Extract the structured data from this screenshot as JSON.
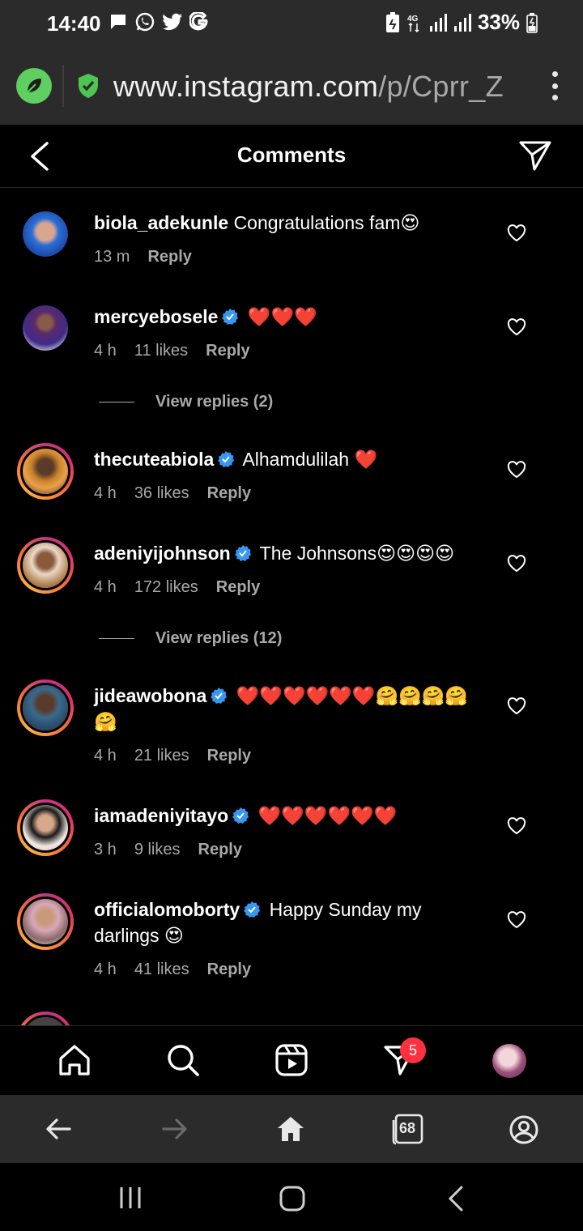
{
  "status_bar": {
    "time": "14:40",
    "left_icons": [
      "message-icon",
      "whatsapp-icon",
      "twitter-icon",
      "google-icon"
    ],
    "network": "4G",
    "battery_percent": "33%"
  },
  "browser": {
    "url_host": "www.instagram.com",
    "url_path": "/p/Cprr_Z",
    "accent_color": "#5fcf62",
    "shield_color": "#4cc552"
  },
  "header": {
    "title": "Comments"
  },
  "comments": [
    {
      "username": "biola_adekunle",
      "verified": false,
      "text": "Congratulations fam😍",
      "time": "13 m",
      "likes": "",
      "reply": "Reply",
      "ring": false
    },
    {
      "username": "mercyebosele",
      "verified": true,
      "text": "❤️❤️❤️",
      "time": "4 h",
      "likes": "11 likes",
      "reply": "Reply",
      "ring": false
    },
    {
      "username": "thecuteabiola",
      "verified": true,
      "text": "Alhamdulilah ❤️",
      "time": "4 h",
      "likes": "36 likes",
      "reply": "Reply",
      "ring": true
    },
    {
      "username": "adeniyijohnson",
      "verified": true,
      "text": "The Johnsons😍😍😍😍",
      "time": "4 h",
      "likes": "172 likes",
      "reply": "Reply",
      "ring": true
    },
    {
      "username": "jideawobona",
      "verified": true,
      "text": "❤️❤️❤️❤️❤️❤️🤗🤗🤗🤗🤗",
      "time": "4 h",
      "likes": "21 likes",
      "reply": "Reply",
      "ring": true
    },
    {
      "username": "iamadeniyitayo",
      "verified": true,
      "text": "❤️❤️❤️❤️❤️❤️",
      "time": "3 h",
      "likes": "9 likes",
      "reply": "Reply",
      "ring": true
    },
    {
      "username": "officialomoborty",
      "verified": true,
      "text": "Happy Sunday my darlings 😍",
      "time": "4 h",
      "likes": "41 likes",
      "reply": "Reply",
      "ring": true
    }
  ],
  "view_replies": [
    "View replies (2)",
    "View replies (12)"
  ],
  "nav": {
    "items": [
      "home-icon",
      "search-icon",
      "reels-icon",
      "direct-icon",
      "profile-avatar"
    ],
    "direct_badge": "5"
  },
  "browser_nav": {
    "tabs_count": "68"
  },
  "colors": {
    "verified_blue": "#3897f0",
    "badge_red": "#ff3040",
    "meta_gray": "#a8a8a8"
  }
}
